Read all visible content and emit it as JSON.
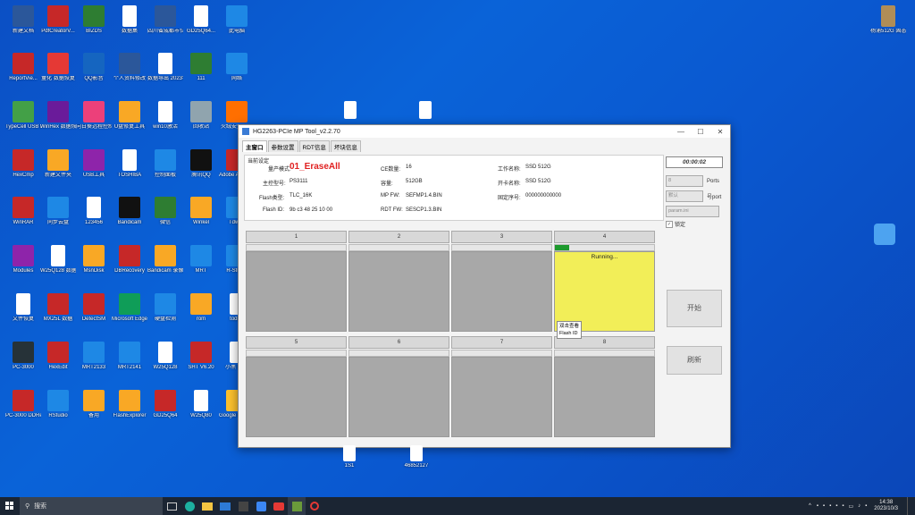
{
  "desktop_icons": [
    {
      "label": "新建文档",
      "color": "#2b579a"
    },
    {
      "label": "PdfCreatorV...",
      "color": "#c62828"
    },
    {
      "label": "BIZDS",
      "color": "#2e7d32"
    },
    {
      "label": "数据集",
      "color": "#ffffff"
    },
    {
      "label": "四川省成都市位置",
      "color": "#2b579a"
    },
    {
      "label": "GD25Q64...",
      "color": "#ffffff"
    },
    {
      "label": "杨浦512G 固态硬盘",
      "color": "#8e24aa"
    },
    {
      "label": "此电脑",
      "color": "#1e88e5"
    },
    {
      "label": "ReportVie...",
      "color": "#c62828"
    },
    {
      "label": "量化 数据恢复",
      "color": "#e53935"
    },
    {
      "label": "QQ影音",
      "color": "#1565c0"
    },
    {
      "label": "个人资料修改",
      "color": "#2b579a"
    },
    {
      "label": "数据导出 2023年6...",
      "color": "#ffffff"
    },
    {
      "label": "111",
      "color": "#2e7d32"
    },
    {
      "label": "网络",
      "color": "#1e88e5"
    },
    {
      "label": "TypeCell USB Editor",
      "color": "#43a047"
    },
    {
      "label": "WinHex 数据恢复",
      "color": "#6a1b9a"
    },
    {
      "label": "向日葵远程控制",
      "color": "#ec407a"
    },
    {
      "label": "U盘修复工具",
      "color": "#f9a825"
    },
    {
      "label": "win10激活",
      "color": "#ffffff"
    },
    {
      "label": "回收站",
      "color": "#90a4ae"
    },
    {
      "label": "火绒安全软件",
      "color": "#ff6f00"
    },
    {
      "label": "HexCmp",
      "color": "#c62828"
    },
    {
      "label": "新建文件夹",
      "color": "#f9a825"
    },
    {
      "label": "USB工具",
      "color": "#8e24aa"
    },
    {
      "label": "TOSHIBA",
      "color": "#ffffff"
    },
    {
      "label": "控制面板",
      "color": "#1e88e5"
    },
    {
      "label": "腾讯QQ",
      "color": "#111111"
    },
    {
      "label": "Adobe Acrobat DC",
      "color": "#c62828"
    },
    {
      "label": "WinRAR",
      "color": "#c62828"
    },
    {
      "label": "同步云盘",
      "color": "#1e88e5"
    },
    {
      "label": "123456",
      "color": "#ffffff"
    },
    {
      "label": "Bandicam",
      "color": "#111111"
    },
    {
      "label": "微信",
      "color": "#2e7d32"
    },
    {
      "label": "Winkel",
      "color": "#f9a825"
    },
    {
      "label": "Tdweb",
      "color": "#1e88e5"
    },
    {
      "label": "Modules",
      "color": "#8e24aa"
    },
    {
      "label": "W25Q128 数据BIN",
      "color": "#ffffff"
    },
    {
      "label": "MsnDisk",
      "color": "#f9a825"
    },
    {
      "label": "DBRecovery",
      "color": "#c62828"
    },
    {
      "label": "Bandicam 录像文件",
      "color": "#f9a825"
    },
    {
      "label": "MRT",
      "color": "#1e88e5"
    },
    {
      "label": "R-Studio",
      "color": "#1e88e5"
    },
    {
      "label": "文件恢复",
      "color": "#ffffff"
    },
    {
      "label": "MX25L 数据",
      "color": "#c62828"
    },
    {
      "label": "DetectSM",
      "color": "#c62828"
    },
    {
      "label": "Microsoft Edge",
      "color": "#0f9d58"
    },
    {
      "label": "硬盘检测",
      "color": "#1e88e5"
    },
    {
      "label": "rom",
      "color": "#f9a825"
    },
    {
      "label": "todisk",
      "color": "#ffffff"
    },
    {
      "label": "PC-3000",
      "color": "#263238"
    },
    {
      "label": "HexEdit",
      "color": "#c62828"
    },
    {
      "label": "MRT2133",
      "color": "#1e88e5"
    },
    {
      "label": "MRT2141",
      "color": "#1e88e5"
    },
    {
      "label": "W25Q128",
      "color": "#ffffff"
    },
    {
      "label": "SHT V6.20",
      "color": "#c62828"
    },
    {
      "label": "小黑 数据",
      "color": "#ffffff"
    },
    {
      "label": "PC-3000 DDRescue",
      "color": "#c62828"
    },
    {
      "label": "RStudio",
      "color": "#1e88e5"
    },
    {
      "label": "备用",
      "color": "#f9a825"
    },
    {
      "label": "FlashExplorer",
      "color": "#f9a825"
    },
    {
      "label": "GD25Q64",
      "color": "#c62828"
    },
    {
      "label": "W25Q80",
      "color": "#ffffff"
    },
    {
      "label": "Google Chrome",
      "color": "#fbc02d"
    }
  ],
  "window": {
    "title": "HG2263-PCIe MP Tool_v2.2.70",
    "tabs": [
      "主窗口",
      "参数设置",
      "RDT信息",
      "坏块信息"
    ],
    "panel_header": "当前设定",
    "fields": {
      "mode_label": "量产模式:",
      "mode_value": "01_EraseAll",
      "ce_label": "CE数量:",
      "ce_value": "16",
      "work_name_label": "工作名称:",
      "work_name_value": "SSD 512G",
      "controller_label": "主控型号:",
      "controller_value": "PS3111",
      "capacity_label": "容量:",
      "capacity_value": "512GB",
      "card_name_label": "开卡名称:",
      "card_name_value": "SSD 512G",
      "flash_type_label": "Flash类型:",
      "flash_type_value": "TLC_16K",
      "mp_fw_label": "MP FW:",
      "mp_fw_value": "SEFMP1.4.BIN",
      "serial_label": "固定序号:",
      "serial_value": "000000000000",
      "flash_id_label": "Flash ID:",
      "flash_id_value": "9b c3 48 25 10 00",
      "rdt_fw_label": "RDT FW:",
      "rdt_fw_value": "SESCP1.3.BIN"
    },
    "timer": "00:00:02",
    "ports_select": "8",
    "ports_label": "Ports",
    "mode_select": "默认",
    "mode_port_label": "号port",
    "ini_select": "param.ini",
    "lock_label": "锁定",
    "start_button": "开始",
    "refresh_button": "刷新",
    "ports": [
      {
        "label": "1",
        "state": "idle"
      },
      {
        "label": "2",
        "state": "idle"
      },
      {
        "label": "3",
        "state": "idle"
      },
      {
        "label": "4",
        "state": "running",
        "status": "Running...",
        "progress": 0.14
      },
      {
        "label": "5",
        "state": "idle"
      },
      {
        "label": "6",
        "state": "idle"
      },
      {
        "label": "7",
        "state": "idle"
      },
      {
        "label": "8",
        "state": "idle"
      }
    ],
    "tooltip": [
      "双击查看",
      "Flash ID"
    ]
  },
  "desktop_files": [
    {
      "label": "1S1"
    },
    {
      "label": "46852127"
    }
  ],
  "taskbar": {
    "search_placeholder": "搜索",
    "time": "14:38",
    "date": "2023/10/3"
  }
}
